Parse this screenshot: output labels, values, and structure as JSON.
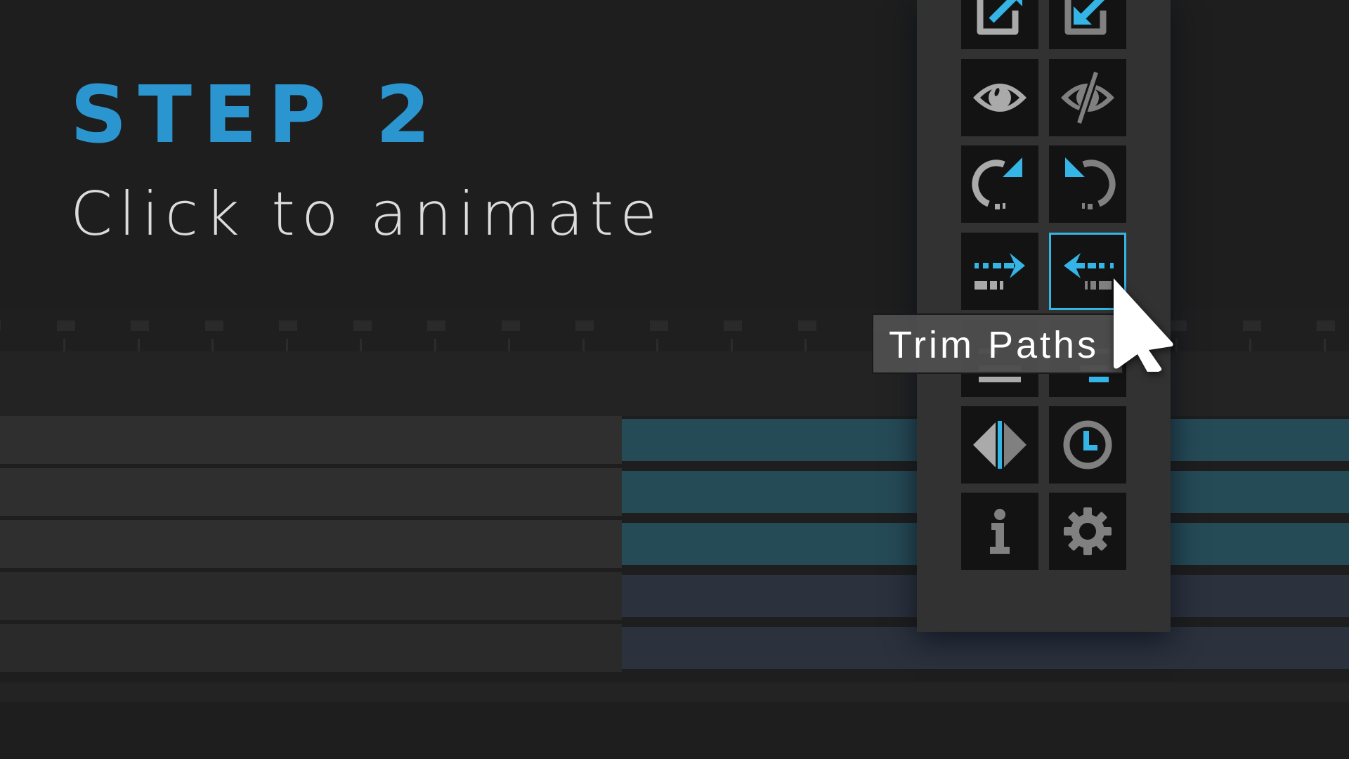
{
  "heading": "STEP 2",
  "subheading": "Click to animate",
  "tooltip": "Trim Paths",
  "colors": {
    "accent": "#35b4e6",
    "heading": "#2b95d0",
    "panel_bg": "#323232",
    "tile_bg": "#131313",
    "icon_light": "#aaaaaa",
    "icon_dark": "#808080",
    "track_bar_teal": "#254b57",
    "track_bar_navy": "#2b313d"
  },
  "panel": {
    "buttons": [
      {
        "name": "export-button",
        "icon": "box-arrow-out-icon",
        "selected": false
      },
      {
        "name": "import-button",
        "icon": "box-arrow-in-icon",
        "selected": false
      },
      {
        "name": "show-button",
        "icon": "eye-icon",
        "selected": false
      },
      {
        "name": "hide-button",
        "icon": "eye-slash-icon",
        "selected": false
      },
      {
        "name": "rotate-in-button",
        "icon": "rotate-clockwise-icon",
        "selected": false
      },
      {
        "name": "rotate-out-button",
        "icon": "rotate-counterclockwise-icon",
        "selected": false
      },
      {
        "name": "trim-paths-in-button",
        "icon": "dashed-arrow-right-icon",
        "selected": false
      },
      {
        "name": "trim-paths-button",
        "icon": "dashed-arrow-left-icon",
        "selected": true
      },
      {
        "name": "align-left-button",
        "icon": "line-bar-icon",
        "selected": false
      },
      {
        "name": "align-right-button",
        "icon": "accent-bar-icon",
        "selected": false
      },
      {
        "name": "mirror-button",
        "icon": "mirror-diamond-icon",
        "selected": false
      },
      {
        "name": "timing-button",
        "icon": "clock-icon",
        "selected": false
      },
      {
        "name": "info-button",
        "icon": "info-icon",
        "selected": false
      },
      {
        "name": "settings-button",
        "icon": "gear-icon",
        "selected": false
      }
    ]
  },
  "timeline": {
    "tracks": [
      {
        "type": "teal"
      },
      {
        "type": "teal"
      },
      {
        "type": "teal"
      },
      {
        "type": "navy"
      },
      {
        "type": "navy"
      }
    ]
  }
}
